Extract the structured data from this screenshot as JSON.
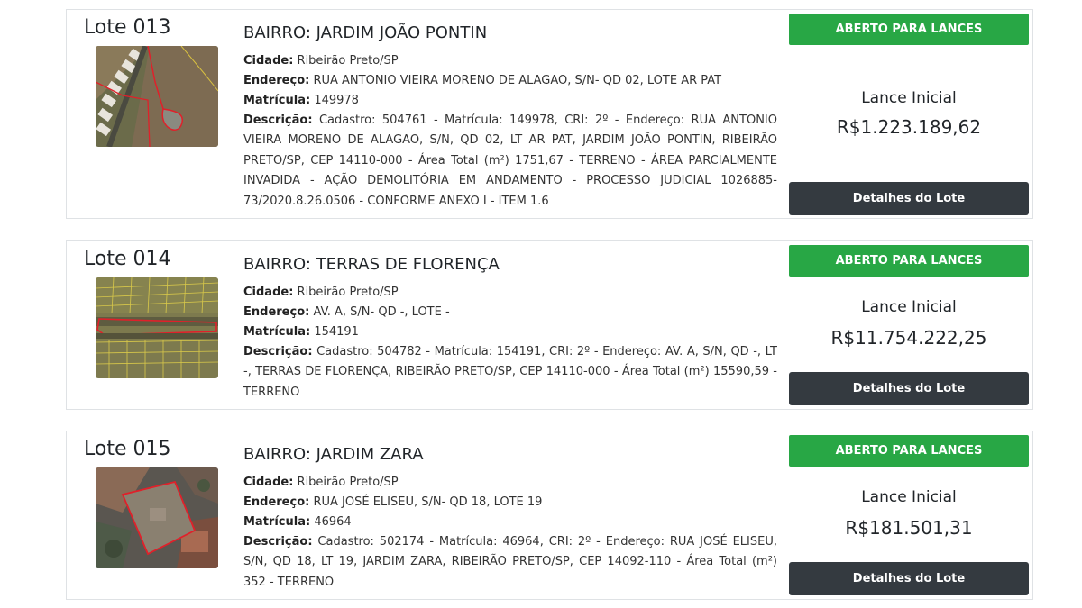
{
  "lots": [
    {
      "number": "Lote 013",
      "bairro": "BAIRRO: JARDIM JOÃO PONTIN",
      "cidade_label": "Cidade:",
      "cidade": " Ribeirão Preto/SP",
      "endereco_label": "Endereço:",
      "endereco": " RUA ANTONIO VIEIRA MORENO DE ALAGAO, S/N- QD 02, LOTE AR PAT",
      "matricula_label": "Matrícula:",
      "matricula": " 149978",
      "descricao_label": "Descrição:",
      "descricao": " Cadastro: 504761 - Matrícula: 149978, CRI: 2º - Endereço: RUA ANTONIO VIEIRA MORENO DE ALAGAO, S/N, QD 02, LT AR PAT, JARDIM JOÃO PONTIN, RIBEIRÃO PRETO/SP, CEP 14110-000 - Área Total (m²) 1751,67 - TERRENO - ÁREA PARCIALMENTE INVADIDA - AÇÃO DEMOLITÓRIA EM ANDAMENTO - PROCESSO JUDICIAL 1026885-73/2020.8.26.0506 - CONFORME ANEXO I - ITEM 1.6",
      "status": "ABERTO PARA LANCES",
      "lance_label": "Lance Inicial",
      "lance_value": "R$1.223.189,62",
      "details_button": "Detalhes do Lote"
    },
    {
      "number": "Lote 014",
      "bairro": "BAIRRO: TERRAS DE FLORENÇA",
      "cidade_label": "Cidade:",
      "cidade": " Ribeirão Preto/SP",
      "endereco_label": "Endereço:",
      "endereco": " AV. A, S/N- QD -, LOTE -",
      "matricula_label": "Matrícula:",
      "matricula": " 154191",
      "descricao_label": "Descrição:",
      "descricao": " Cadastro: 504782 - Matrícula: 154191, CRI: 2º - Endereço: AV. A, S/N, QD -, LT -, TERRAS DE FLORENÇA, RIBEIRÃO PRETO/SP, CEP 14110-000 - Área Total (m²) 15590,59 - TERRENO",
      "status": "ABERTO PARA LANCES",
      "lance_label": "Lance Inicial",
      "lance_value": "R$11.754.222,25",
      "details_button": "Detalhes do Lote"
    },
    {
      "number": "Lote 015",
      "bairro": "BAIRRO: JARDIM ZARA",
      "cidade_label": "Cidade:",
      "cidade": " Ribeirão Preto/SP",
      "endereco_label": "Endereço:",
      "endereco": " RUA JOSÉ ELISEU, S/N- QD 18, LOTE 19",
      "matricula_label": "Matrícula:",
      "matricula": " 46964",
      "descricao_label": "Descrição:",
      "descricao": " Cadastro: 502174 - Matrícula: 46964, CRI: 2º - Endereço: RUA JOSÉ ELISEU, S/N, QD 18, LT 19, JARDIM ZARA, RIBEIRÃO PRETO/SP, CEP 14092-110 - Área Total (m²) 352 - TERRENO",
      "status": "ABERTO PARA LANCES",
      "lance_label": "Lance Inicial",
      "lance_value": "R$181.501,31",
      "details_button": "Detalhes do Lote"
    }
  ],
  "colors": {
    "status_green": "#28a745",
    "details_dark": "#343a40",
    "parcel_outline": "#e0202a"
  }
}
